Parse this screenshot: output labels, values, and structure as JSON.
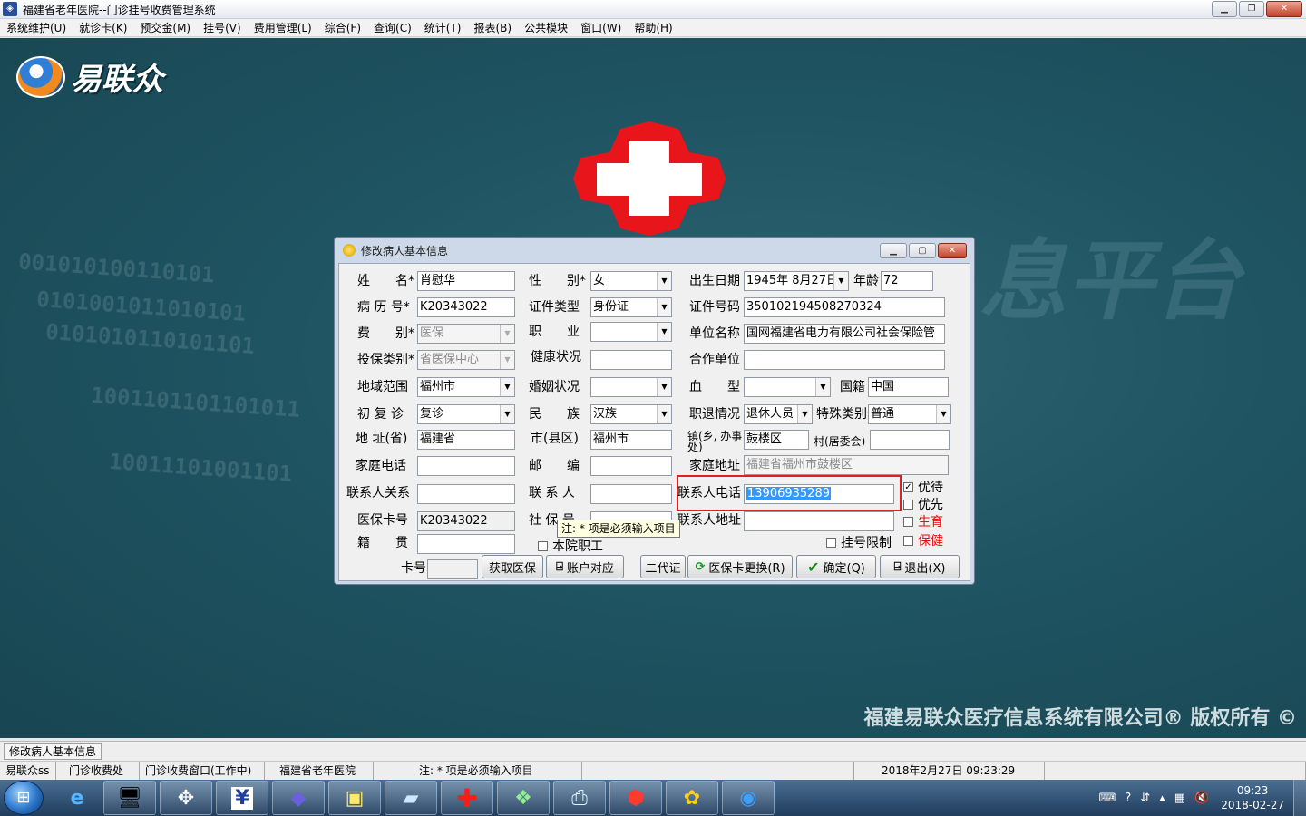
{
  "window": {
    "title": "福建省老年医院--门诊挂号收费管理系统"
  },
  "menu": [
    "系统维护(U)",
    "就诊卡(K)",
    "预交金(M)",
    "挂号(V)",
    "费用管理(L)",
    "综合(F)",
    "查询(C)",
    "统计(T)",
    "报表(B)",
    "公共模块",
    "窗口(W)",
    "帮助(H)"
  ],
  "background": {
    "logo_text": "易联众",
    "binary_rows": [
      "001010100110101",
      "0101001011010101",
      "0101010110101101",
      "1001101101101011",
      "10011101001101"
    ],
    "watermark": "息平台",
    "copyright": "福建易联众医疗信息系统有限公司® 版权所有 ©"
  },
  "dialog": {
    "title": "修改病人基本信息",
    "labels": {
      "name": "姓　　名*",
      "gender": "性　　别*",
      "birth": "出生日期",
      "age": "年龄",
      "record_no": "病 历 号*",
      "id_type": "证件类型",
      "id_no": "证件号码",
      "fee_type": "费　　别*",
      "occupation": "职　　业",
      "employer": "单位名称",
      "insure_type": "投保类别*",
      "health": "健康状况",
      "coop_unit": "合作单位",
      "region": "地域范围",
      "marital": "婚姻状况",
      "blood": "血　　型",
      "nation": "国籍",
      "visit_type": "初 复 诊",
      "ethnic": "民　　族",
      "retire": "职退情况",
      "special": "特殊类别",
      "province": "地 址(省)",
      "city": "市(县区)",
      "street": "镇(乡, 办事处)",
      "village": "村(居委会)",
      "home_phone": "家庭电话",
      "postcode": "邮　　编",
      "home_addr": "家庭地址",
      "contact_rel": "联系人关系",
      "contact": "联 系 人",
      "contact_phone": "联系人电话",
      "card_no": "医保卡号",
      "social_no": "社 保 号",
      "contact_addr": "联系人地址",
      "native": "籍　　贯",
      "card": "卡号"
    },
    "values": {
      "name": "肖慰华",
      "gender": "女",
      "birth": "1945年 8月27日",
      "age": "72",
      "record_no": "K20343022",
      "id_type": "身份证",
      "id_no": "350102194508270324",
      "fee_type": "医保",
      "occupation": "",
      "employer": "国网福建省电力有限公司社会保险管",
      "insure_type": "省医保中心",
      "health": "",
      "coop_unit": "",
      "region": "福州市",
      "marital": "",
      "blood": "",
      "nation": "中国",
      "visit_type": "复诊",
      "ethnic": "汉族",
      "retire": "退休人员",
      "special": "普通",
      "province": "福建省",
      "city": "福州市",
      "street": "鼓楼区",
      "village": "",
      "home_phone": "",
      "postcode": "",
      "home_addr": "福建省福州市鼓楼区",
      "contact_rel": "",
      "contact": "",
      "contact_phone": "13906935289",
      "card_no": "K20343022",
      "social_no": "",
      "contact_addr": "",
      "native": "",
      "card": ""
    },
    "checks": {
      "priority": {
        "label": "优待",
        "checked": true
      },
      "first": {
        "label": "优先",
        "checked": false
      },
      "birth_ins": {
        "label": "生育",
        "checked": false
      },
      "health_care": {
        "label": "保健",
        "checked": false
      },
      "staff": {
        "label": "本院职工",
        "checked": false
      },
      "reg_limit": {
        "label": "挂号限制",
        "checked": false
      }
    },
    "tooltip": "注: * 项是必须输入项目",
    "buttons": {
      "get_insurance": "获取医保",
      "account": "账户对应",
      "second_id": "二代证",
      "card_change": "医保卡更换(R)",
      "ok": "确定(Q)",
      "exit": "退出(X)"
    }
  },
  "status1": "修改病人基本信息",
  "status2": [
    "易联众ss",
    "门诊收费处",
    "门诊收费窗口(工作中)",
    "福建省老年医院",
    "注: * 项是必须输入项目",
    "",
    "2018年2月27日 09:23:29",
    ""
  ],
  "taskbar": {
    "items": [
      "ie-icon",
      "computer-icon",
      "compass-icon",
      "finance-icon",
      "diamond-icon",
      "user-card-icon",
      "book-icon",
      "red-cross-icon",
      "network-icon",
      "print-icon",
      "medkit-icon",
      "gold-icon",
      "app-logo-icon"
    ],
    "time": "09:23",
    "date": "2018-02-27"
  }
}
